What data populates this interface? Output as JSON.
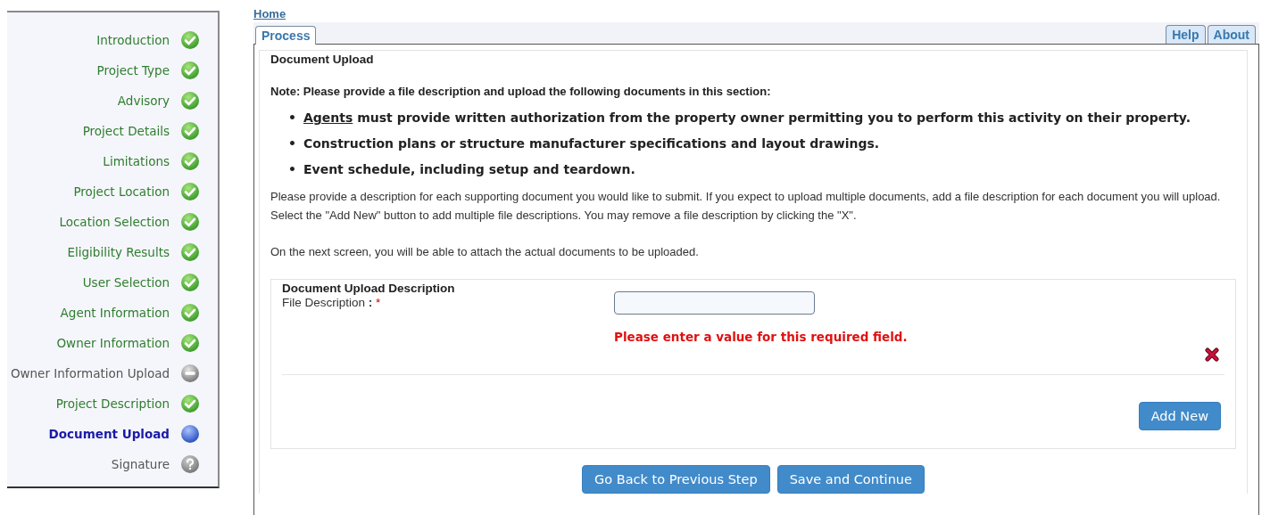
{
  "sidebar": {
    "steps": [
      {
        "label": "Introduction",
        "kind": "complete"
      },
      {
        "label": "Project Type",
        "kind": "complete"
      },
      {
        "label": "Advisory",
        "kind": "complete"
      },
      {
        "label": "Project Details",
        "kind": "complete"
      },
      {
        "label": "Limitations",
        "kind": "complete"
      },
      {
        "label": "Project Location",
        "kind": "complete"
      },
      {
        "label": "Location Selection",
        "kind": "complete"
      },
      {
        "label": "Eligibility Results",
        "kind": "complete"
      },
      {
        "label": "User Selection",
        "kind": "complete"
      },
      {
        "label": "Agent Information",
        "kind": "complete"
      },
      {
        "label": "Owner Information",
        "kind": "complete"
      },
      {
        "label": "Owner Information Upload",
        "kind": "skipped"
      },
      {
        "label": "Project Description",
        "kind": "complete"
      },
      {
        "label": "Document Upload",
        "kind": "current"
      },
      {
        "label": "Signature",
        "kind": "pending"
      }
    ]
  },
  "breadcrumb": "Home",
  "tabs": [
    {
      "label": "Process",
      "selected": true
    }
  ],
  "side_tabs": [
    {
      "label": "Help",
      "selected": false
    },
    {
      "label": "About",
      "selected": false
    }
  ],
  "section": {
    "title": "Document Upload",
    "note": "Note: Please provide a file description and upload the following documents in this section:",
    "bullets": [
      {
        "marker": "•",
        "lead": "Agents",
        "text": " must provide written authorization from the property owner permitting you to perform this activity on their property."
      },
      {
        "marker": "•",
        "text": "Construction plans or structure manufacturer specifications and layout drawings."
      },
      {
        "marker": "•",
        "text": "Event schedule, including setup and teardown."
      }
    ],
    "paragraphs": [
      "Please provide a description for each supporting document you would like to submit. If you expect to upload multiple documents, add a file description for each document you will upload. Select the \"Add New\" button to add multiple file descriptions. You may remove a file description by clicking the \"X\".",
      "On the next screen, you will be able to attach the actual documents to be uploaded."
    ],
    "upload": {
      "title": "Document Upload Description",
      "field_label": "File Description",
      "separator": ":",
      "required_mark": "*",
      "error": "Please enter a value for this required field.",
      "add_button": "Add New"
    },
    "buttons": [
      "Go Back to Previous Step",
      "Save and Continue"
    ]
  }
}
